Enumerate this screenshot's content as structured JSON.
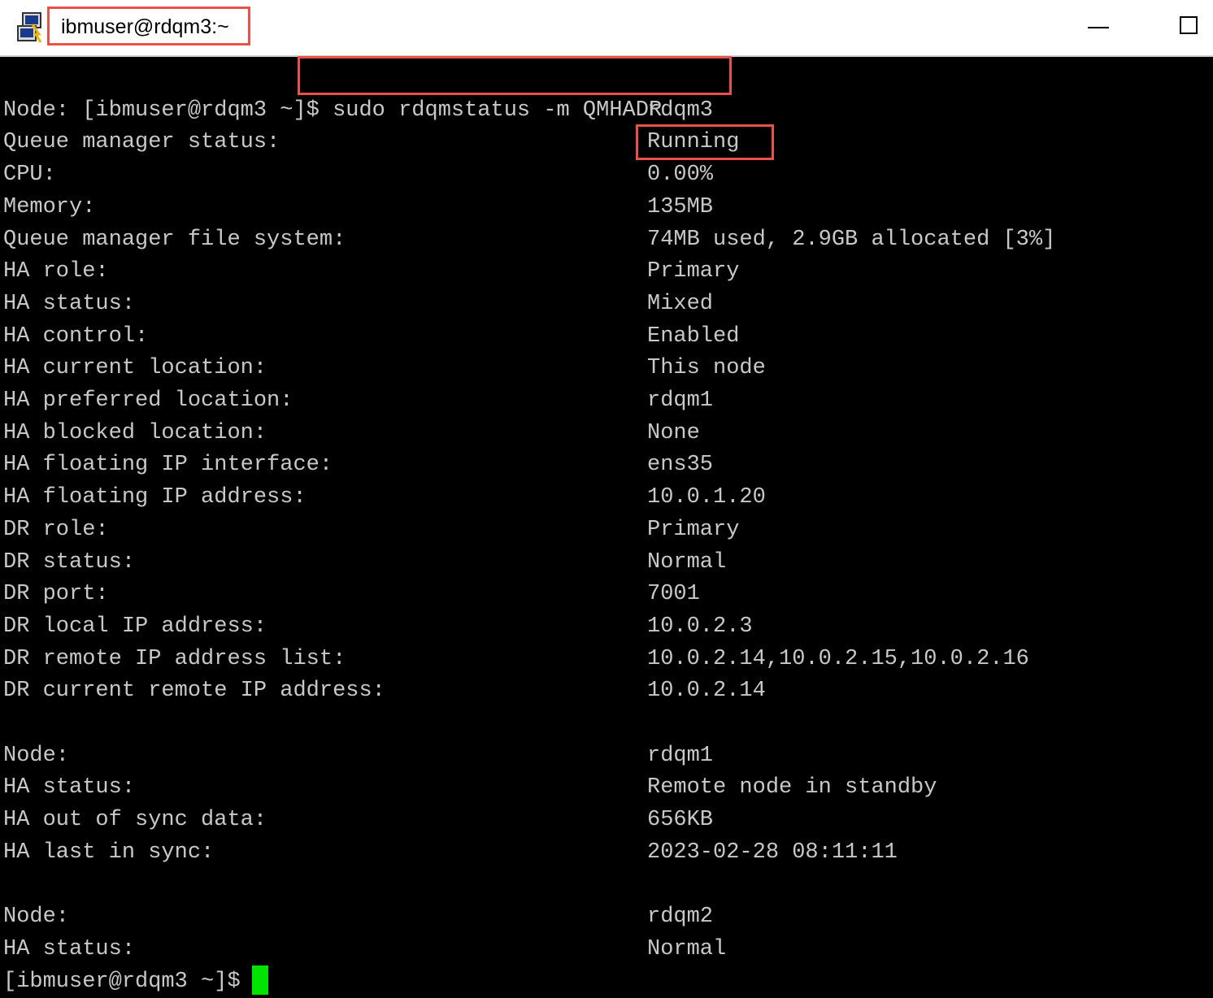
{
  "window": {
    "title": "ibmuser@rdqm3:~",
    "colors": {
      "terminal_bg": "#000000",
      "terminal_text": "#c8c8c8",
      "highlight_box": "#e8524a",
      "cursor": "#00e400"
    },
    "icons": [
      "putty-app-icon",
      "minimize-icon",
      "maximize-icon"
    ]
  },
  "terminal": {
    "prompt": "[ibmuser@rdqm3 ~]$",
    "command": "sudo rdqmstatus -m QMHADR",
    "sections": [
      {
        "rows": [
          {
            "label": "Node:",
            "value": "rdqm3"
          },
          {
            "label": "Queue manager status:",
            "value": "Running"
          },
          {
            "label": "CPU:",
            "value": "0.00%"
          },
          {
            "label": "Memory:",
            "value": "135MB"
          },
          {
            "label": "Queue manager file system:",
            "value": "74MB used, 2.9GB allocated [3%]"
          },
          {
            "label": "HA role:",
            "value": "Primary"
          },
          {
            "label": "HA status:",
            "value": "Mixed"
          },
          {
            "label": "HA control:",
            "value": "Enabled"
          },
          {
            "label": "HA current location:",
            "value": "This node"
          },
          {
            "label": "HA preferred location:",
            "value": "rdqm1"
          },
          {
            "label": "HA blocked location:",
            "value": "None"
          },
          {
            "label": "HA floating IP interface:",
            "value": "ens35"
          },
          {
            "label": "HA floating IP address:",
            "value": "10.0.1.20"
          },
          {
            "label": "DR role:",
            "value": "Primary"
          },
          {
            "label": "DR status:",
            "value": "Normal"
          },
          {
            "label": "DR port:",
            "value": "7001"
          },
          {
            "label": "DR local IP address:",
            "value": "10.0.2.3"
          },
          {
            "label": "DR remote IP address list:",
            "value": "10.0.2.14,10.0.2.15,10.0.2.16"
          },
          {
            "label": "DR current remote IP address:",
            "value": "10.0.2.14"
          }
        ]
      },
      {
        "rows": [
          {
            "label": "Node:",
            "value": "rdqm1"
          },
          {
            "label": "HA status:",
            "value": "Remote node in standby"
          },
          {
            "label": "HA out of sync data:",
            "value": "656KB"
          },
          {
            "label": "HA last in sync:",
            "value": "2023-02-28 08:11:11"
          }
        ]
      },
      {
        "rows": [
          {
            "label": "Node:",
            "value": "rdqm2"
          },
          {
            "label": "HA status:",
            "value": "Normal"
          }
        ]
      }
    ]
  }
}
